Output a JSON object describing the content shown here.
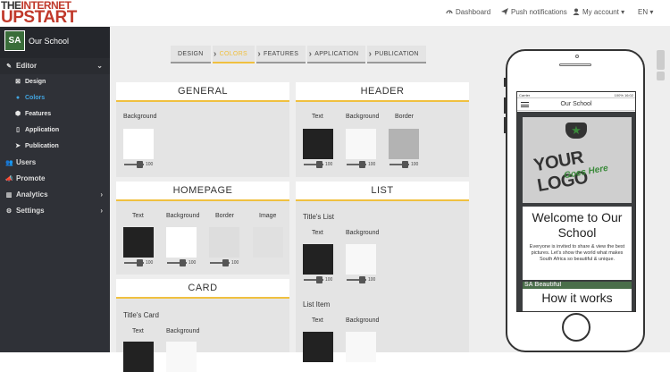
{
  "brand": {
    "line1_a": "THE",
    "line1_b": "INTERNET",
    "line2": "UPSTART"
  },
  "topnav": {
    "dashboard": "Dashboard",
    "push": "Push notifications",
    "account": "My account",
    "lang": "EN"
  },
  "sidebar": {
    "school_avatar": "SA",
    "school_name": "Our School",
    "items": [
      {
        "label": "Editor",
        "icon": "pencil-icon"
      },
      {
        "label": "Design",
        "icon": "design-icon"
      },
      {
        "label": "Colors",
        "icon": "palette-icon"
      },
      {
        "label": "Features",
        "icon": "cube-icon"
      },
      {
        "label": "Application",
        "icon": "mobile-icon"
      },
      {
        "label": "Publication",
        "icon": "send-icon"
      },
      {
        "label": "Users",
        "icon": "users-icon"
      },
      {
        "label": "Promote",
        "icon": "bullhorn-icon"
      },
      {
        "label": "Analytics",
        "icon": "bar-chart-icon"
      },
      {
        "label": "Settings",
        "icon": "cogs-icon"
      }
    ]
  },
  "steps": [
    "DESIGN",
    "COLORS",
    "FEATURES",
    "APPLICATION",
    "PUBLICATION"
  ],
  "panels": {
    "general": {
      "title": "GENERAL",
      "background": "Background",
      "bg_color": "#ffffff",
      "bg_opacity": "100"
    },
    "header": {
      "title": "HEADER",
      "text": "Text",
      "background": "Background",
      "border": "Border",
      "text_color": "#222222",
      "bg_color": "#f8f8f8",
      "border_color": "#b3b3b3",
      "v1": "100",
      "v2": "100",
      "v3": "100"
    },
    "homepage": {
      "title": "HOMEPAGE",
      "text": "Text",
      "background": "Background",
      "border": "Border",
      "image": "Image",
      "text_color": "#222222",
      "bg_color": "#ffffff",
      "border_color": "#dddddd",
      "image_color": "#e0e0e0",
      "v1": "100",
      "v2": "100",
      "v3": "100"
    },
    "list": {
      "title": "LIST",
      "s1": "Title's List",
      "s2": "List Item",
      "text": "Text",
      "background": "Background",
      "c1": "#222222",
      "c2": "#f8f8f8",
      "v1": "100",
      "v2": "100"
    },
    "card": {
      "title": "CARD",
      "s1": "Title's Card",
      "text": "Text",
      "background": "Background"
    }
  },
  "phone": {
    "carrier": "Carrier",
    "status_right": "100% 16:02",
    "app_title": "Our School",
    "logo_line1": "YOUR LOGO",
    "logo_line2": "Goes Here",
    "welcome_title": "Welcome to Our School",
    "welcome_text": "Everyone is invited to share & view the best pictures. Let's show the world what makes South Africa so beautiful & unique.",
    "strip_text": "SA Beautiful",
    "how": "How it works"
  }
}
